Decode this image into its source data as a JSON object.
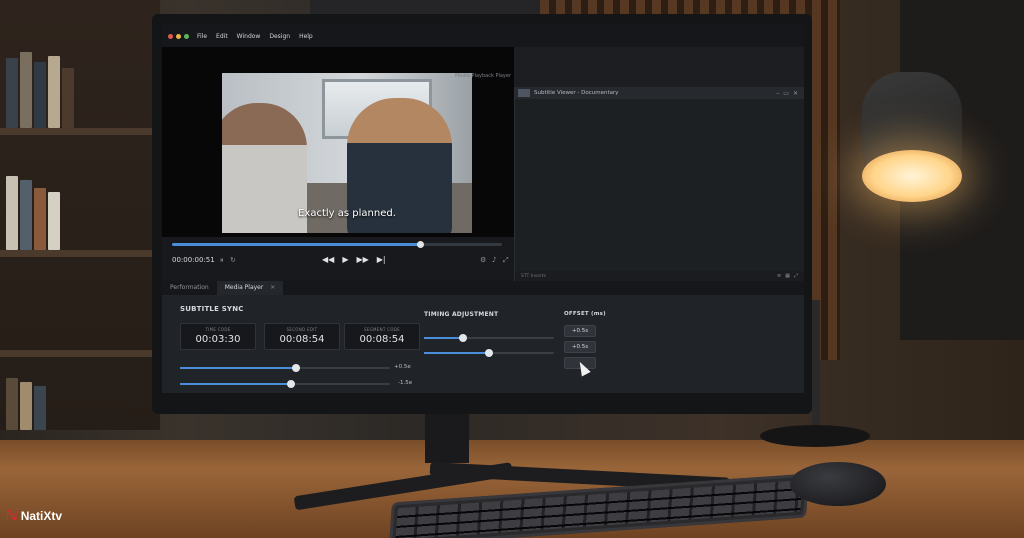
{
  "watermark": {
    "brand": "NatiXtv"
  },
  "menubar": {
    "items": [
      "File",
      "Edit",
      "Window",
      "Design",
      "Help"
    ],
    "traffic_colors": [
      "#e25a4f",
      "#e9b748",
      "#5ab85a"
    ]
  },
  "window": {
    "title": "Media Playback Player"
  },
  "player": {
    "subtitle_line": "Exactly as planned.",
    "current_time": "00:00:00:51",
    "progress": 0.75,
    "transport": {
      "prev": "◀◀",
      "play": "▶",
      "next": "▶▶",
      "end": "▶|"
    }
  },
  "subtitle_viewer": {
    "title": "Subtitle Viewer - Documentary",
    "footer_text": "STT Inserts"
  },
  "tabs": [
    {
      "label": "Performation",
      "active": false
    },
    {
      "label": "Media Player",
      "active": true
    }
  ],
  "subtitle_sync": {
    "title": "SUBTITLE SYNC",
    "timecodes": [
      {
        "label": "TIME CODE",
        "value": "00:03:30"
      },
      {
        "label": "SECOND EDIT",
        "value": "00:08:54"
      },
      {
        "label": "SEGMENT CODE",
        "value": "00:08:54"
      }
    ],
    "sliders": [
      {
        "level": 0.55,
        "value": "+0.5e"
      },
      {
        "level": 0.53,
        "value": "-1.5e"
      }
    ]
  },
  "timing_adjustment": {
    "title": "TIMING ADJUSTMENT",
    "sliders": [
      {
        "level": 0.3
      },
      {
        "level": 0.5
      }
    ]
  },
  "offset": {
    "title": "OFFSET (ms)",
    "buttons": [
      "+0.5s",
      "+0.5s",
      ""
    ]
  },
  "accent_color": "#4a8dd8"
}
